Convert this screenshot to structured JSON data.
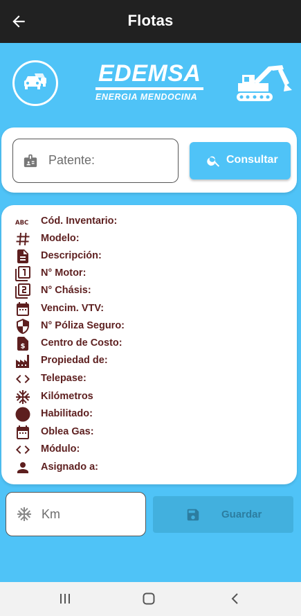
{
  "appbar": {
    "title": "Flotas",
    "back_icon": "arrow-left-icon"
  },
  "header": {
    "logo_main": "EDEMSA",
    "logo_sub": "ENERGIA MENDOCINA",
    "left_icon": "car-icon",
    "right_icon": "excavator-icon"
  },
  "search": {
    "placeholder": "Patente:",
    "button_label": "Consultar",
    "icon": "badge-icon"
  },
  "details": {
    "rows": [
      {
        "label": "Cód. Inventario:",
        "icon": "abc-icon"
      },
      {
        "label": "Modelo:",
        "icon": "hash-icon"
      },
      {
        "label": "Descripción:",
        "icon": "document-icon"
      },
      {
        "label": "N° Motor:",
        "icon": "filter-1-icon"
      },
      {
        "label": "N° Chásis:",
        "icon": "filter-2-icon"
      },
      {
        "label": "Vencim. VTV:",
        "icon": "calendar-icon"
      },
      {
        "label": "N° Póliza Seguro:",
        "icon": "shield-icon"
      },
      {
        "label": "Centro de Costo:",
        "icon": "cost-document-icon"
      },
      {
        "label": "Propiedad de:",
        "icon": "factory-icon"
      },
      {
        "label": "Telepase:",
        "icon": "code-icon"
      },
      {
        "label": "Kilómetros",
        "icon": "snowflake-icon"
      },
      {
        "label": "Habilitado:",
        "icon": "circle-icon"
      },
      {
        "label": "Oblea Gas:",
        "icon": "calendar-icon"
      },
      {
        "label": "Módulo:",
        "icon": "code-icon"
      },
      {
        "label": "Asignado a:",
        "icon": "person-icon"
      }
    ]
  },
  "km": {
    "placeholder": "Km",
    "icon": "snowflake-icon"
  },
  "save": {
    "label": "Guardar",
    "icon": "save-icon"
  },
  "colors": {
    "accent": "#4fc3f7",
    "appbar": "#212121",
    "label": "#5d1f1f"
  }
}
